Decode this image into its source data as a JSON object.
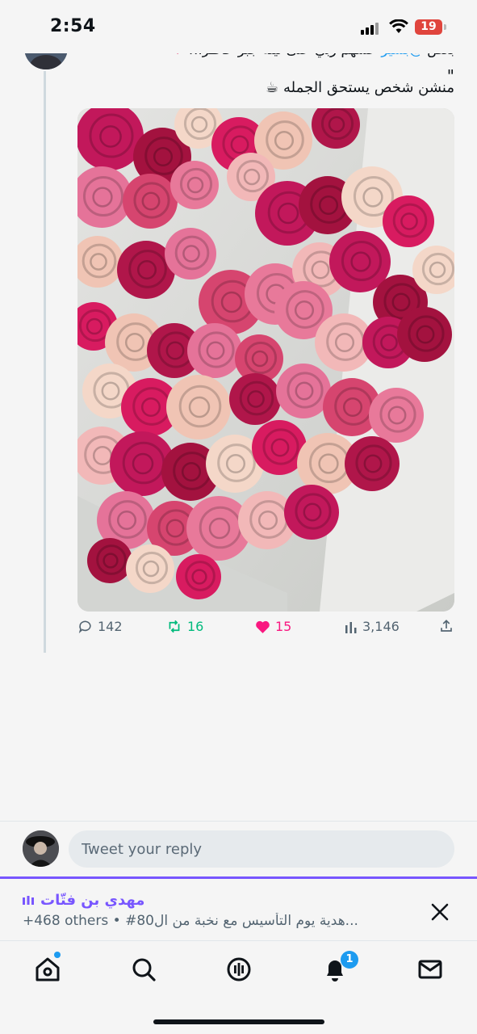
{
  "status_bar": {
    "time": "2:54",
    "battery": "19"
  },
  "tweet": {
    "text_line1_prefix": "بعض",
    "mention": "@بشير",
    "text_line1_rest": "عشهم ربي على نيته جبر خاطر..!",
    "quote_mark": "\"",
    "text_line2": "منشن شخص يستحق الجمله ☕",
    "media_desc": "bouquet-of-roses",
    "stats": {
      "replies": "142",
      "retweets": "16",
      "likes": "15",
      "views": "3,146"
    },
    "colors": {
      "retweet": "#00ba7c",
      "like": "#f91880",
      "stat": "#536471"
    }
  },
  "composer": {
    "placeholder": "Tweet your reply"
  },
  "space": {
    "host": "مهدي بن فتّات",
    "title": "#80هدية يوم التأسيس مع نخبة من ال...",
    "others": "+468 others",
    "accent": "#7856ff"
  },
  "tabs": [
    "home-icon",
    "search-icon",
    "spaces-icon",
    "notifications-icon",
    "messages-icon"
  ],
  "notifications_badge": "1"
}
